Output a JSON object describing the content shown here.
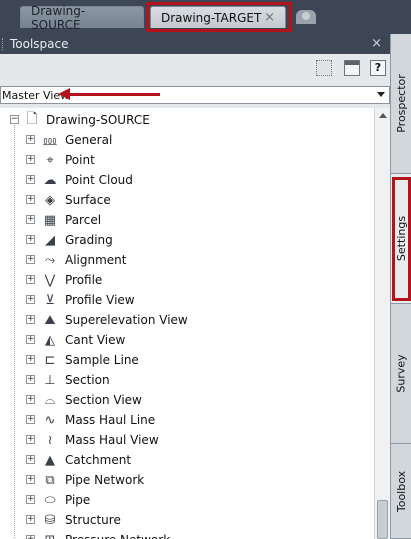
{
  "tabs": {
    "source_label": "Drawing-SOURCE",
    "target_label": "Drawing-TARGET",
    "close_glyph": "×"
  },
  "toolspace": {
    "title": "Toolspace",
    "close_glyph": "×",
    "help_label": "?"
  },
  "view_select": {
    "value": "Master View"
  },
  "tree": {
    "root": "Drawing-SOURCE",
    "items": [
      {
        "label": "General",
        "icon": "general-icon",
        "glyph": "⅏"
      },
      {
        "label": "Point",
        "icon": "point-icon",
        "glyph": "⌖"
      },
      {
        "label": "Point Cloud",
        "icon": "point-cloud-icon",
        "glyph": "☁"
      },
      {
        "label": "Surface",
        "icon": "surface-icon",
        "glyph": "◈"
      },
      {
        "label": "Parcel",
        "icon": "parcel-icon",
        "glyph": "▦"
      },
      {
        "label": "Grading",
        "icon": "grading-icon",
        "glyph": "◢"
      },
      {
        "label": "Alignment",
        "icon": "alignment-icon",
        "glyph": "⤳"
      },
      {
        "label": "Profile",
        "icon": "profile-icon",
        "glyph": "⋁"
      },
      {
        "label": "Profile View",
        "icon": "profile-view-icon",
        "glyph": "⊻"
      },
      {
        "label": "Superelevation View",
        "icon": "superelevation-view-icon",
        "glyph": "⛰"
      },
      {
        "label": "Cant View",
        "icon": "cant-view-icon",
        "glyph": "◭"
      },
      {
        "label": "Sample Line",
        "icon": "sample-line-icon",
        "glyph": "⊏"
      },
      {
        "label": "Section",
        "icon": "section-icon",
        "glyph": "⊥"
      },
      {
        "label": "Section View",
        "icon": "section-view-icon",
        "glyph": "⌓"
      },
      {
        "label": "Mass Haul Line",
        "icon": "mass-haul-line-icon",
        "glyph": "∿"
      },
      {
        "label": "Mass Haul View",
        "icon": "mass-haul-view-icon",
        "glyph": "≀"
      },
      {
        "label": "Catchment",
        "icon": "catchment-icon",
        "glyph": "▲"
      },
      {
        "label": "Pipe Network",
        "icon": "pipe-network-icon",
        "glyph": "⧉"
      },
      {
        "label": "Pipe",
        "icon": "pipe-icon",
        "glyph": "⬭"
      },
      {
        "label": "Structure",
        "icon": "structure-icon",
        "glyph": "⛁"
      },
      {
        "label": "Pressure Network",
        "icon": "pressure-network-icon",
        "glyph": "⊞"
      }
    ]
  },
  "side_tabs": {
    "prospector": "Prospector",
    "settings": "Settings",
    "survey": "Survey",
    "toolbox": "Toolbox"
  },
  "colors": {
    "highlight": "#b3141b",
    "panel_bg": "#e5e8eb",
    "chrome_bg": "#3d4654"
  }
}
